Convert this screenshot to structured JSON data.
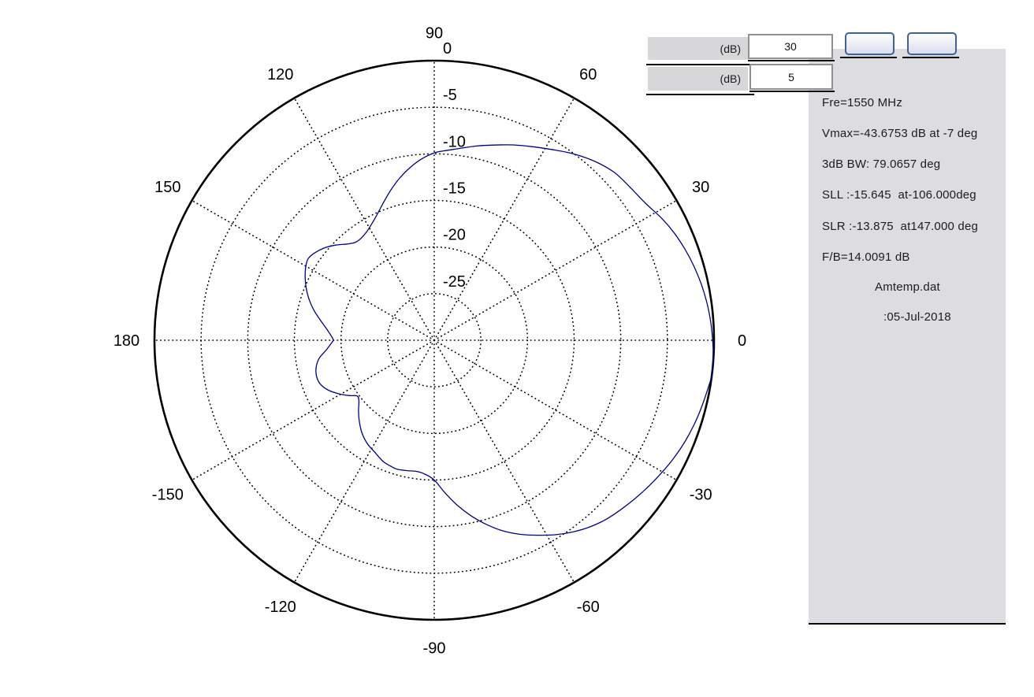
{
  "controls": {
    "range_label": "(dB)",
    "range_value": "30",
    "step_label": "(dB)",
    "step_value": "5",
    "button1_label": "",
    "button2_label": ""
  },
  "info_panel": {
    "lines": [
      "Fre=1550 MHz",
      "Vmax=-43.6753 dB at -7 deg",
      "3dB BW: 79.0657 deg",
      "SLL :-15.645  at-106.000deg",
      "SLR :-13.875  at147.000 deg",
      "F/B=14.0091 dB"
    ],
    "file_name": "Amtemp.dat",
    "date": ":05-Jul-2018"
  },
  "chart_data": {
    "type": "line",
    "subtype": "polar-radiation-pattern",
    "title": "",
    "angle_ticks_deg": [
      0,
      30,
      60,
      90,
      120,
      150,
      180,
      -150,
      -120,
      -90,
      -60,
      -30
    ],
    "radial_ticks_db": [
      0,
      -5,
      -10,
      -15,
      -20,
      -25
    ],
    "r_range_db": [
      -30,
      0
    ],
    "grid": "dotted",
    "colors": {
      "curve": "#00008B",
      "grid": "#000000",
      "outer_circle": "#000000"
    },
    "stats_shown": {
      "freq_MHz": 1550,
      "vmax_dB": -43.6753,
      "vmax_angle_deg": -7,
      "bw3dB_deg": 79.0657,
      "SLL_dB": -15.645,
      "SLL_angle_deg": -106,
      "SLR_dB": -13.875,
      "SLR_angle_deg": 147,
      "front_to_back_dB": 14.0091
    },
    "series": [
      {
        "name": "normalized-pattern-dB",
        "points_deg_db": [
          [
            -180,
            -19.2
          ],
          [
            -175,
            -18.4
          ],
          [
            -171,
            -17.5
          ],
          [
            -167,
            -17.0
          ],
          [
            -163,
            -16.8
          ],
          [
            -159,
            -16.9
          ],
          [
            -155,
            -17.4
          ],
          [
            -151,
            -18.2
          ],
          [
            -147,
            -19.1
          ],
          [
            -144,
            -19.8
          ],
          [
            -141,
            -19.6
          ],
          [
            -137,
            -18.9
          ],
          [
            -133,
            -18.2
          ],
          [
            -128,
            -17.4
          ],
          [
            -123,
            -16.8
          ],
          [
            -118,
            -16.4
          ],
          [
            -113,
            -15.9
          ],
          [
            -109,
            -15.7
          ],
          [
            -106,
            -15.6
          ],
          [
            -102,
            -15.7
          ],
          [
            -98,
            -15.8
          ],
          [
            -94,
            -15.6
          ],
          [
            -90,
            -15.0
          ],
          [
            -86,
            -13.6
          ],
          [
            -82,
            -12.1
          ],
          [
            -78,
            -10.7
          ],
          [
            -74,
            -9.4
          ],
          [
            -70,
            -8.2
          ],
          [
            -66,
            -7.2
          ],
          [
            -62,
            -6.3
          ],
          [
            -58,
            -5.4
          ],
          [
            -54,
            -4.6
          ],
          [
            -50,
            -3.9
          ],
          [
            -46,
            -3.35
          ],
          [
            -42,
            -2.95
          ],
          [
            -38,
            -2.55
          ],
          [
            -34,
            -2.15
          ],
          [
            -30,
            -1.75
          ],
          [
            -26,
            -1.35
          ],
          [
            -22,
            -1.0
          ],
          [
            -18,
            -0.7
          ],
          [
            -14,
            -0.45
          ],
          [
            -10,
            -0.2
          ],
          [
            -7,
            0
          ],
          [
            -3,
            -0.05
          ],
          [
            0,
            -0.15
          ],
          [
            4,
            -0.3
          ],
          [
            8,
            -0.5
          ],
          [
            12,
            -0.75
          ],
          [
            16,
            -1.05
          ],
          [
            20,
            -1.4
          ],
          [
            24,
            -1.8
          ],
          [
            28,
            -2.3
          ],
          [
            33,
            -3.0
          ],
          [
            38,
            -3.35
          ],
          [
            43,
            -3.6
          ],
          [
            48,
            -4.2
          ],
          [
            53,
            -5.0
          ],
          [
            58,
            -5.9
          ],
          [
            63,
            -6.7
          ],
          [
            68,
            -7.4
          ],
          [
            73,
            -8.1
          ],
          [
            78,
            -8.7
          ],
          [
            83,
            -9.3
          ],
          [
            87,
            -9.65
          ],
          [
            90,
            -9.9
          ],
          [
            94,
            -10.5
          ],
          [
            98,
            -11.3
          ],
          [
            102,
            -12.2
          ],
          [
            106,
            -13.2
          ],
          [
            110,
            -14.2
          ],
          [
            114,
            -15.1
          ],
          [
            118,
            -15.8
          ],
          [
            122,
            -16.3
          ],
          [
            126,
            -16.55
          ],
          [
            129,
            -16.5
          ],
          [
            132,
            -16.1
          ],
          [
            136,
            -15.3
          ],
          [
            140,
            -14.6
          ],
          [
            144,
            -14.1
          ],
          [
            147,
            -13.9
          ],
          [
            150,
            -14.1
          ],
          [
            154,
            -14.6
          ],
          [
            158,
            -15.2
          ],
          [
            162,
            -15.9
          ],
          [
            166,
            -16.7
          ],
          [
            170,
            -17.6
          ],
          [
            174,
            -18.4
          ],
          [
            178,
            -19.0
          ],
          [
            180,
            -19.2
          ]
        ]
      }
    ]
  }
}
